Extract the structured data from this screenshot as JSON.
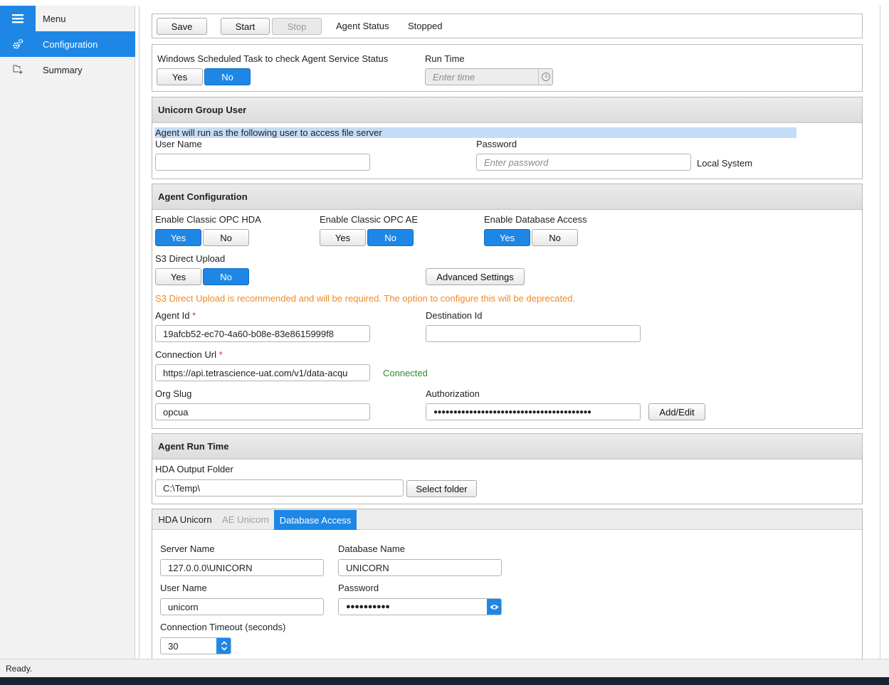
{
  "sidebar": {
    "items": [
      {
        "label": "Menu",
        "icon": "hamburger-icon"
      },
      {
        "label": "Configuration",
        "icon": "gears-icon"
      },
      {
        "label": "Summary",
        "icon": "tree-add-icon"
      }
    ]
  },
  "toolbar": {
    "save": "Save",
    "start": "Start",
    "stop": "Stop",
    "status_label": "Agent Status",
    "status_value": "Stopped"
  },
  "scheduled": {
    "label": "Windows Scheduled Task to check Agent Service Status",
    "yes": "Yes",
    "no": "No",
    "selected": "No",
    "run_time_label": "Run Time",
    "run_time_placeholder": "Enter time"
  },
  "group_user": {
    "title": "Unicorn Group User",
    "info": "Agent will run as the following user to access file server",
    "username_label": "User Name",
    "username_value": "",
    "password_label": "Password",
    "password_placeholder": "Enter password",
    "local_system": "Local System"
  },
  "agent_config": {
    "title": "Agent Configuration",
    "hda_label": "Enable Classic OPC HDA",
    "hda_selected": "Yes",
    "ae_label": "Enable Classic OPC AE",
    "ae_selected": "No",
    "db_label": "Enable Database Access",
    "db_selected": "Yes",
    "s3_label": "S3 Direct Upload",
    "s3_selected": "No",
    "yes": "Yes",
    "no": "No",
    "advanced": "Advanced Settings",
    "warning": "S3 Direct Upload is recommended and will be required. The option to configure this will be deprecated.",
    "agent_id_label": "Agent Id",
    "agent_id_value": "19afcb52-ec70-4a60-b08e-83e8615999f8",
    "destination_label": "Destination Id",
    "destination_value": "",
    "conn_url_label": "Connection Url",
    "conn_url_value": "https://api.tetrascience-uat.com/v1/data-acqu",
    "connected": "Connected",
    "org_slug_label": "Org Slug",
    "org_slug_value": "opcua",
    "auth_label": "Authorization",
    "auth_value": "●●●●●●●●●●●●●●●●●●●●●●●●●●●●●●●●●●●●●●●●",
    "add_edit": "Add/Edit",
    "required_mark": "*"
  },
  "run_time": {
    "title": "Agent Run Time",
    "hda_folder_label": "HDA Output Folder",
    "hda_folder_value": "C:\\Temp\\",
    "select_folder": "Select folder"
  },
  "tabs": {
    "items": [
      "HDA Unicorn",
      "AE Unicorn",
      "Database Access"
    ],
    "active": "Database Access"
  },
  "db": {
    "server_label": "Server Name",
    "server_value": "127.0.0.0\\UNICORN",
    "dbname_label": "Database Name",
    "dbname_value": "UNICORN",
    "user_label": "User Name",
    "user_value": "unicorn",
    "password_label": "Password",
    "password_value": "●●●●●●●●●●",
    "timeout_label": "Connection Timeout (seconds)",
    "timeout_value": "30"
  },
  "statusbar": {
    "text": "Ready."
  },
  "colors": {
    "accent": "#1e87e5",
    "warning": "#f08a24",
    "connected": "#2e8b2e",
    "highlight": "#c4dcf5"
  }
}
